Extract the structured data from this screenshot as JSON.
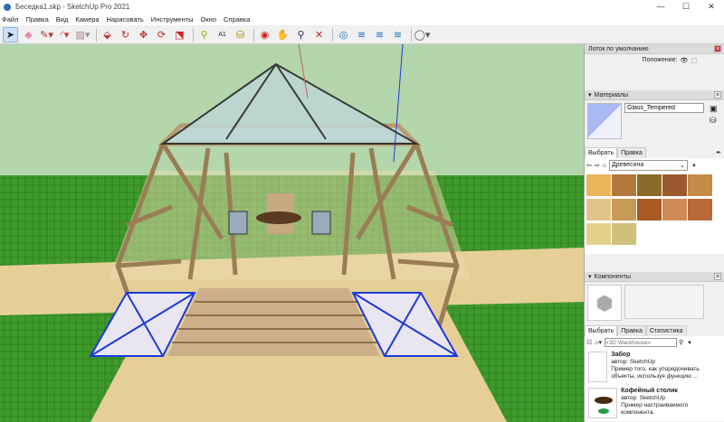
{
  "window": {
    "title": "Беседка1.skp - SketchUp Pro 2021",
    "minimize": "—",
    "maximize": "☐",
    "close": "✕"
  },
  "menu": [
    "Файл",
    "Правка",
    "Вид",
    "Камера",
    "Нарисовать",
    "Инструменты",
    "Окно",
    "Справка"
  ],
  "toolbar": [
    "select-tool",
    "eraser-tool",
    "pencil-tool",
    "arc-tool",
    "shape-tool",
    "push-pull-tool",
    "follow-me-tool",
    "move-tool",
    "rotate-tool",
    "scale-tool",
    "tape-measure-tool",
    "text-tool",
    "paint-bucket-tool",
    "orbit-tool",
    "pan-tool",
    "zoom-tool",
    "zoom-extents-tool",
    "3d-warehouse",
    "extension-warehouse",
    "layout",
    "account"
  ],
  "tray": {
    "title": "Лоток по умолчанию",
    "position_label": "Положение:"
  },
  "materials": {
    "title": "Материалы",
    "name": "Glass_Tempered",
    "tab_select": "Выбрать",
    "tab_edit": "Правка",
    "library": "Древесина",
    "swatch_colors": [
      "#e8b55a",
      "#b3783c",
      "#8c6a2a",
      "#9a5a2e",
      "#c48b48",
      "#e0c48a",
      "#c89a5a",
      "#a85a22",
      "#d08a58",
      "#b86a38",
      "#e2d08c",
      "#cfc07a"
    ]
  },
  "components": {
    "title": "Компоненты",
    "tab_select": "Выбрать",
    "tab_edit": "Правка",
    "tab_stats": "Статистика",
    "search_placeholder": "«3D Warehouse»",
    "items": [
      {
        "name": "Забор",
        "author": "автор: SketchUp",
        "desc": "Пример того, как упорядочивать объекты, используя функцию ..."
      },
      {
        "name": "Кофейный столик",
        "author": "автор: SketchUp",
        "desc": "Пример настраиваемого компонента."
      }
    ]
  },
  "colors": {
    "sky": "#b4d6ad",
    "grass": "#3f9a2c",
    "sand": "#e6cf96",
    "wood": "#d2b48c"
  }
}
